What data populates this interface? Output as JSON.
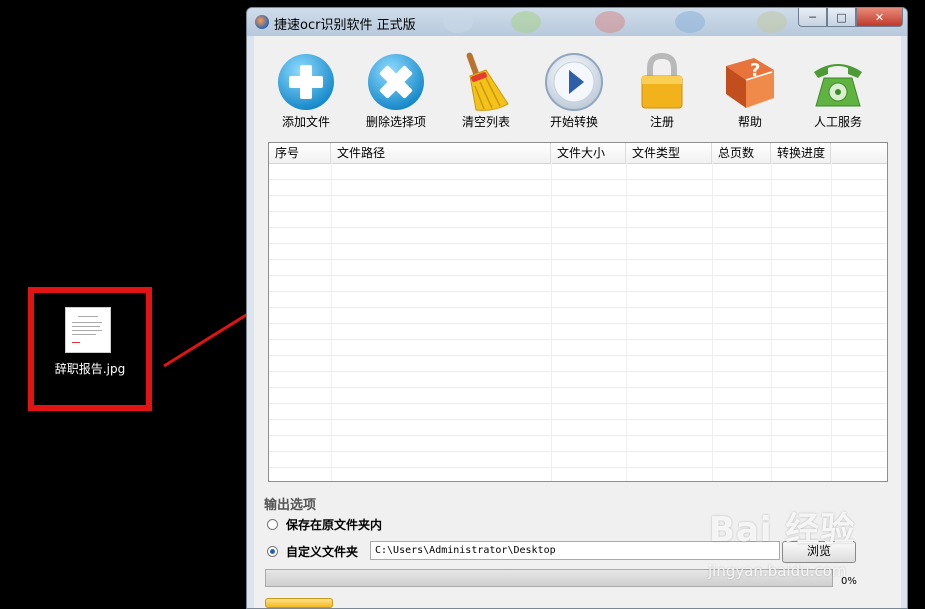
{
  "desktop": {
    "file_name": "辞职报告.jpg"
  },
  "window": {
    "title": "捷速ocr识别软件 正式版",
    "min_glyph": "─",
    "max_glyph": "□",
    "close_glyph": "✕"
  },
  "toolbar": {
    "items": [
      {
        "label": "添加文件",
        "icon": "add-icon"
      },
      {
        "label": "删除选择项",
        "icon": "delete-icon"
      },
      {
        "label": "清空列表",
        "icon": "broom-icon"
      },
      {
        "label": "开始转换",
        "icon": "play-icon"
      },
      {
        "label": "注册",
        "icon": "lock-icon"
      },
      {
        "label": "帮助",
        "icon": "help-book-icon"
      },
      {
        "label": "人工服务",
        "icon": "telephone-icon"
      }
    ]
  },
  "file_list": {
    "columns": [
      "序号",
      "文件路径",
      "文件大小",
      "文件类型",
      "总页数",
      "转换进度"
    ],
    "rows": []
  },
  "output": {
    "section_label": "输出选项",
    "option_original": "保存在原文件夹内",
    "option_custom": "自定义文件夹",
    "selected": "option_custom",
    "path": "C:\\Users\\Administrator\\Desktop",
    "browse_label": "浏览"
  },
  "progress": {
    "value": 0,
    "label": "0%"
  },
  "watermark": {
    "brand": "Bai 经验",
    "url": "jingyan.baidu.com"
  },
  "colors": {
    "highlight_box": "#e11313",
    "arrow": "#e11313",
    "add_button": "#2aa7e0",
    "delete_button": "#2aa7e0"
  }
}
